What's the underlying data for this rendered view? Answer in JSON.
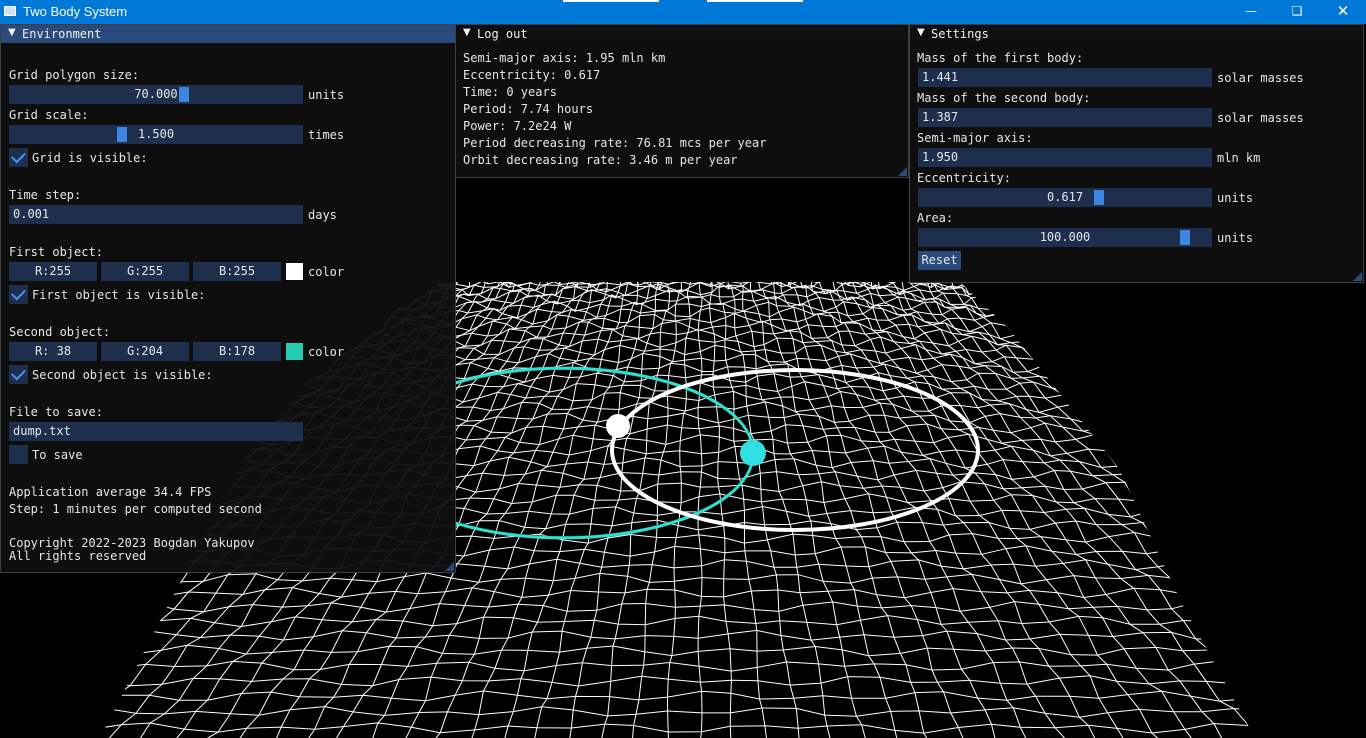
{
  "window": {
    "title": "Two Body System"
  },
  "colors": {
    "first_body": "#ffffff",
    "second_body": "#26ccb2",
    "titlebar": "#0078d7",
    "grid": "#ffffff"
  },
  "environment": {
    "title": "Environment",
    "grid_polygon_size": {
      "label": "Grid polygon size:",
      "value": "70.000",
      "unit": "units",
      "fraction": 0.6
    },
    "grid_scale": {
      "label": "Grid scale:",
      "value": "1.500",
      "unit": "times",
      "fraction": 0.38
    },
    "grid_visible": {
      "label": "Grid is visible:",
      "checked": true
    },
    "time_step": {
      "label": "Time step:",
      "value": "0.001",
      "unit": "days"
    },
    "first_object": {
      "label": "First object:",
      "r": "R:255",
      "g": "G:255",
      "b": "B:255",
      "color_label": "color",
      "visible_label": "First object is visible:",
      "visible": true
    },
    "second_object": {
      "label": "Second object:",
      "r": "R: 38",
      "g": "G:204",
      "b": "B:178",
      "color_label": "color",
      "visible_label": "Second object is visible:",
      "visible": true
    },
    "file_to_save": {
      "label": "File to save:",
      "value": "dump.txt"
    },
    "to_save": {
      "label": "To save",
      "checked": false
    },
    "fps_text": "Application average 34.4 FPS",
    "step_text": "Step: 1 minutes per computed second",
    "copyright": "Copyright 2022-2023 Bogdan Yakupov",
    "rights": "All rights reserved"
  },
  "log": {
    "title": "Log out",
    "lines": [
      "Semi-major axis: 1.95 mln km",
      "Eccentricity: 0.617",
      "Time: 0 years",
      "Period: 7.74 hours",
      "Power: 7.2e24 W",
      "Period decreasing rate: 76.81 mcs per year",
      "Orbit decreasing rate: 3.46 m per year"
    ]
  },
  "settings": {
    "title": "Settings",
    "mass_first": {
      "label": "Mass of the first body:",
      "value": "1.441",
      "unit": "solar masses"
    },
    "mass_second": {
      "label": "Mass of the second body:",
      "value": "1.387",
      "unit": "solar masses"
    },
    "semi_major": {
      "label": "Semi-major axis:",
      "value": "1.950",
      "unit": "mln km"
    },
    "eccentricity": {
      "label": "Eccentricity:",
      "value": "0.617",
      "unit": "units",
      "fraction": 0.62
    },
    "area": {
      "label": "Area:",
      "value": "100.000",
      "unit": "units",
      "fraction": 0.93
    },
    "reset_label": "Reset"
  }
}
